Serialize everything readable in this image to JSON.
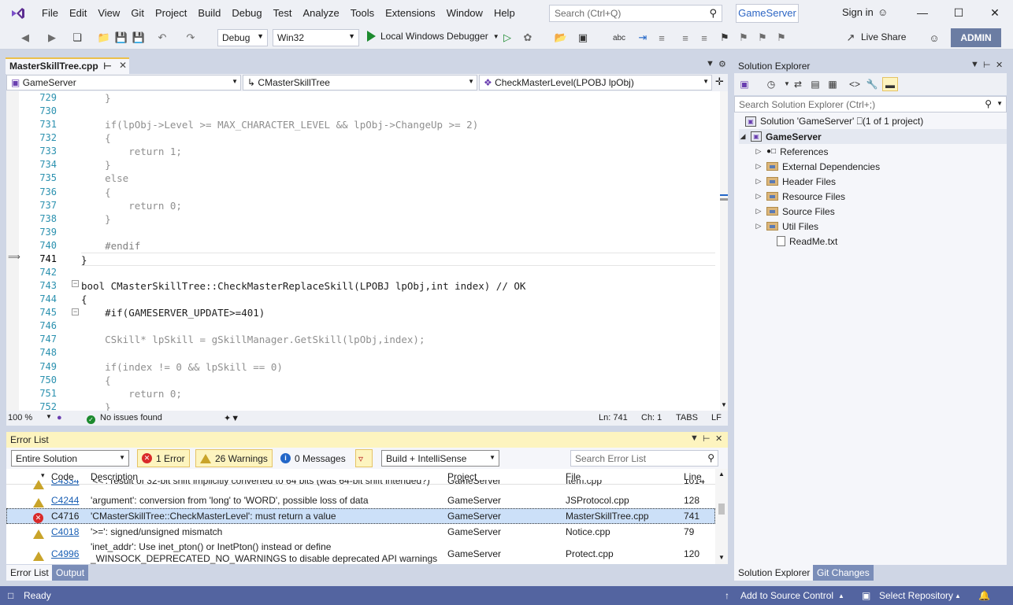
{
  "menu": {
    "items": [
      "File",
      "Edit",
      "View",
      "Git",
      "Project",
      "Build",
      "Debug",
      "Test",
      "Analyze",
      "Tools",
      "Extensions",
      "Window",
      "Help"
    ],
    "search_placeholder": "Search (Ctrl+Q)",
    "solution_name": "GameServer",
    "sign_in": "Sign in"
  },
  "toolbar": {
    "config": "Debug",
    "platform": "Win32",
    "debugger": "Local Windows Debugger",
    "live_share": "Live Share",
    "admin": "ADMIN"
  },
  "editor": {
    "tab_label": "MasterSkillTree.cpp",
    "nav_project": "GameServer",
    "nav_class": "CMasterSkillTree",
    "nav_member": "CheckMasterLevel(LPOBJ lpObj)",
    "current_line": 741,
    "lines": [
      {
        "n": "729",
        "text": "    }"
      },
      {
        "n": "730",
        "text": ""
      },
      {
        "n": "731",
        "text": "    if(lpObj->Level >= MAX_CHARACTER_LEVEL && lpObj->ChangeUp >= 2)"
      },
      {
        "n": "732",
        "text": "    {"
      },
      {
        "n": "733",
        "text": "        return 1;"
      },
      {
        "n": "734",
        "text": "    }"
      },
      {
        "n": "735",
        "text": "    else"
      },
      {
        "n": "736",
        "text": "    {"
      },
      {
        "n": "737",
        "text": "        return 0;"
      },
      {
        "n": "738",
        "text": "    }"
      },
      {
        "n": "739",
        "text": ""
      },
      {
        "n": "740",
        "text": "    #endif"
      },
      {
        "n": "741",
        "text": "}"
      },
      {
        "n": "742",
        "text": ""
      },
      {
        "n": "743",
        "text": "bool CMasterSkillTree::CheckMasterReplaceSkill(LPOBJ lpObj,int index) // OK"
      },
      {
        "n": "744",
        "text": "{"
      },
      {
        "n": "745",
        "text": "    #if(GAMESERVER_UPDATE>=401)"
      },
      {
        "n": "746",
        "text": ""
      },
      {
        "n": "747",
        "text": "    CSkill* lpSkill = gSkillManager.GetSkill(lpObj,index);"
      },
      {
        "n": "748",
        "text": ""
      },
      {
        "n": "749",
        "text": "    if(index != 0 && lpSkill == 0)"
      },
      {
        "n": "750",
        "text": "    {"
      },
      {
        "n": "751",
        "text": "        return 0;"
      },
      {
        "n": "752",
        "text": "    }"
      }
    ],
    "status": {
      "zoom": "100 %",
      "issues": "No issues found",
      "ln": "Ln: 741",
      "ch": "Ch: 1",
      "tabs": "TABS",
      "eol": "LF"
    }
  },
  "error_list": {
    "title": "Error List",
    "scope": "Entire Solution",
    "errors": "1 Error",
    "warnings": "26 Warnings",
    "messages": "0 Messages",
    "build_filter": "Build + IntelliSense",
    "search_placeholder": "Search Error List",
    "columns": [
      "Code",
      "Description",
      "Project",
      "File",
      "Line"
    ],
    "rows": [
      {
        "type": "warning",
        "code": "C4334",
        "desc": "'<<': result of 32-bit shift implicitly converted to 64 bits (was 64-bit shift intended?)",
        "project": "GameServer",
        "file": "Item.cpp",
        "line": "1014"
      },
      {
        "type": "warning",
        "code": "C4244",
        "desc": "'argument': conversion from 'long' to 'WORD', possible loss of data",
        "project": "GameServer",
        "file": "JSProtocol.cpp",
        "line": "128"
      },
      {
        "type": "error",
        "code": "C4716",
        "desc": "'CMasterSkillTree::CheckMasterLevel': must return a value",
        "project": "GameServer",
        "file": "MasterSkillTree.cpp",
        "line": "741"
      },
      {
        "type": "warning",
        "code": "C4018",
        "desc": "'>=': signed/unsigned mismatch",
        "project": "GameServer",
        "file": "Notice.cpp",
        "line": "79"
      },
      {
        "type": "warning",
        "code": "C4996",
        "desc": "'inet_addr': Use inet_pton() or InetPton() instead or define",
        "desc2": "_WINSOCK_DEPRECATED_NO_WARNINGS to disable deprecated API warnings",
        "project": "GameServer",
        "file": "Protect.cpp",
        "line": "120"
      }
    ],
    "tabs": [
      "Error List",
      "Output"
    ]
  },
  "solution_explorer": {
    "title": "Solution Explorer",
    "search_placeholder": "Search Solution Explorer (Ctrl+;)",
    "solution": "Solution 'GameServer' ⎕(1 of 1 project)",
    "project": "GameServer",
    "nodes": [
      "References",
      "External Dependencies",
      "Header Files",
      "Resource Files",
      "Source Files",
      "Util Files",
      "ReadMe.txt"
    ],
    "tabs": [
      "Solution Explorer",
      "Git Changes"
    ]
  },
  "statusbar": {
    "ready": "Ready",
    "source_control": "Add to Source Control",
    "repo": "Select Repository"
  }
}
